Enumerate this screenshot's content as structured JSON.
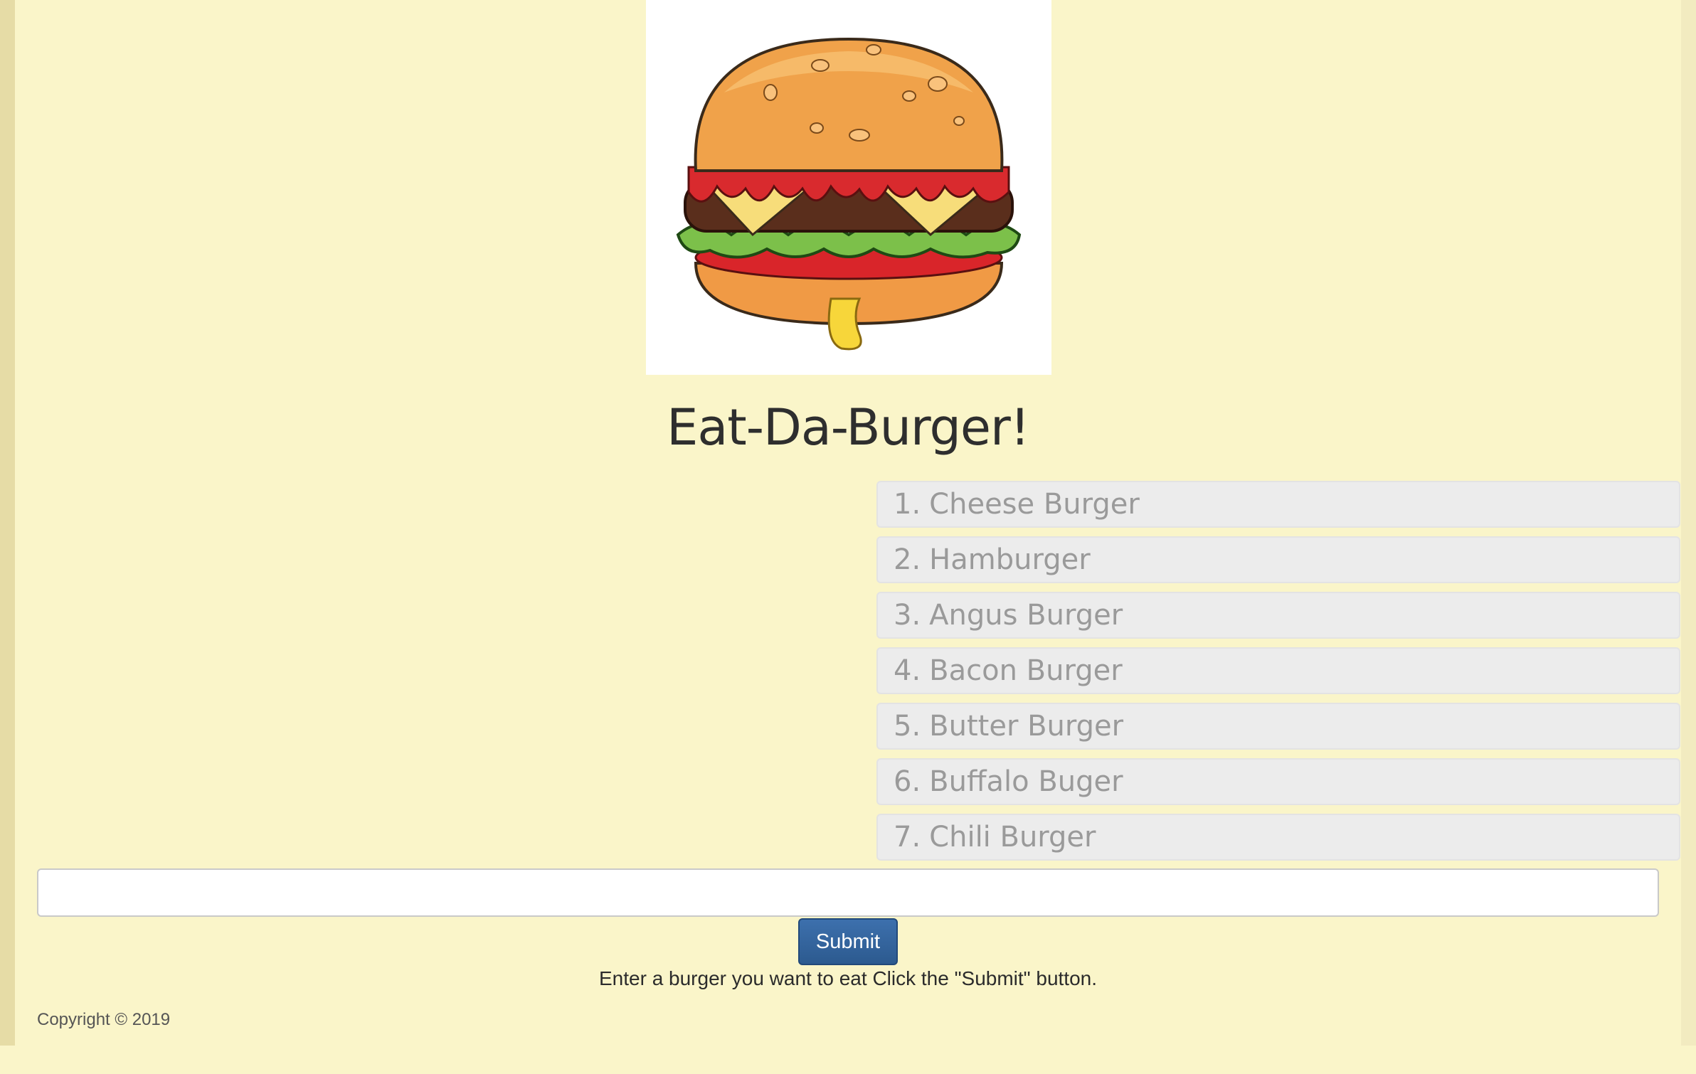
{
  "header": {
    "logo_icon": "hamburger-illustration",
    "title": "Eat-Da-Burger!"
  },
  "burgers": [
    {
      "num": "1.",
      "name": "Cheese Burger"
    },
    {
      "num": "2.",
      "name": "Hamburger"
    },
    {
      "num": "3.",
      "name": "Angus Burger"
    },
    {
      "num": "4.",
      "name": "Bacon Burger"
    },
    {
      "num": "5.",
      "name": "Butter Burger"
    },
    {
      "num": "6.",
      "name": "Buffalo Buger"
    },
    {
      "num": "7.",
      "name": "Chili Burger"
    }
  ],
  "form": {
    "input_value": "",
    "submit_label": "Submit",
    "hint": "Enter a burger you want to eat Click the \"Submit\" button."
  },
  "footer": {
    "copyright": "Copyright © 2019"
  },
  "colors": {
    "page_bg": "#faf5c9",
    "submit_bg": "#335f97",
    "list_item_bg": "#ececec"
  }
}
